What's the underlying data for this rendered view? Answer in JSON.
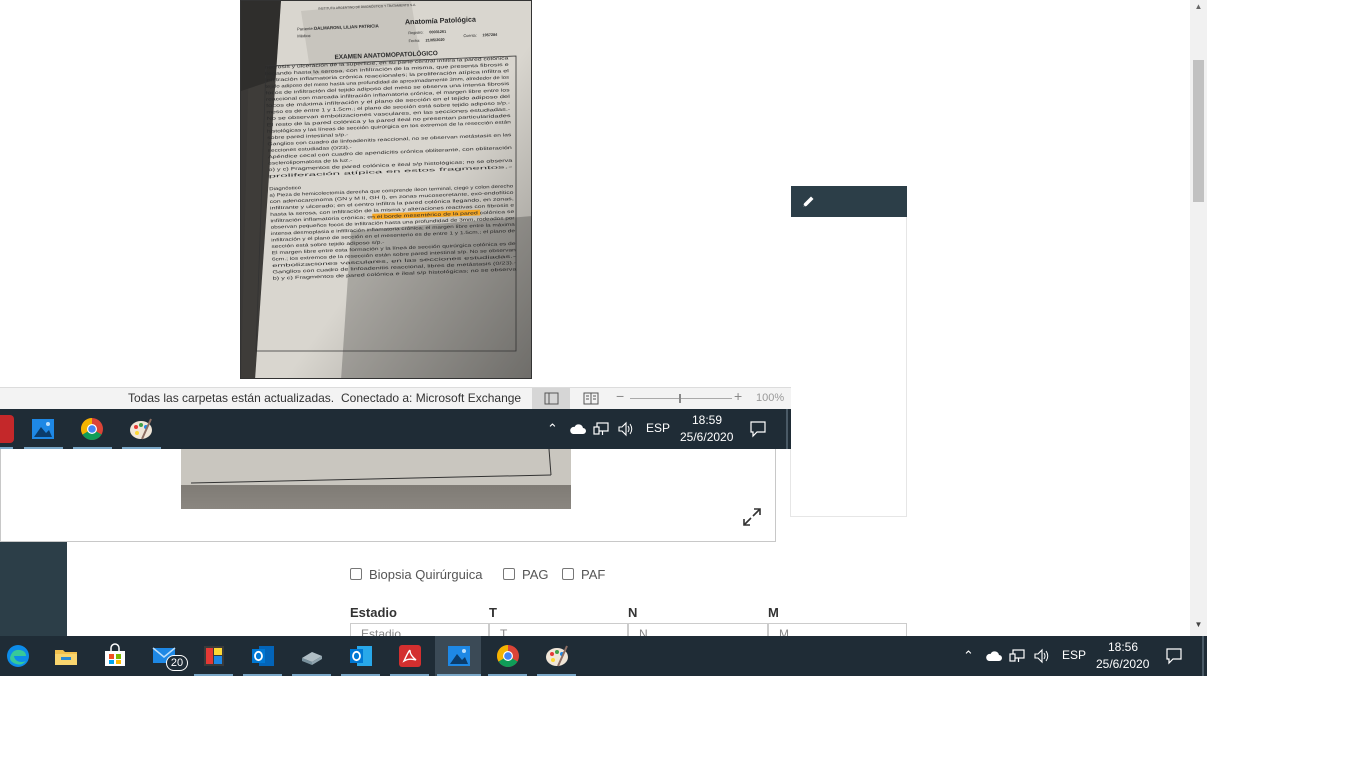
{
  "webpage": {
    "checkboxes": [
      "Biopsia Quirúrguica",
      "PAG",
      "PAF"
    ],
    "stage_headers": [
      "Estadio",
      "T",
      "N",
      "M"
    ],
    "stage_placeholders": [
      "Estadio",
      "T",
      "N",
      "M"
    ]
  },
  "document_photo": {
    "header": {
      "institute": "INSTITUTO ARGENTINO DE DIAGNÓSTICO Y TRATAMIENTO S.A.",
      "department": "Anatomía Patológica",
      "patient_label": "Paciente:",
      "patient_name": "DALMARONI, LILIAN PATRICIA",
      "doctor_label": "Médico:",
      "registro_label": "Registro:",
      "registro": "00031261",
      "fecha_label": "Fecha:",
      "fecha": "21/05/2020",
      "cuenta_label": "Cuenta:",
      "cuenta": "1957284"
    },
    "title": "EXAMEN ANATOMOPATOLÓGICO",
    "body_lines": [
      "necrosis y ulceración de la superficie, en su parte central infiltra la pared colónica",
      "llegando hasta la serosa, con infiltración de la misma, que presenta fibrosis e",
      "infiltración inflamatoria crónica reaccionales; la proliferación atípica infiltra el",
      "tejido adiposo del meso hasta una profundidad de aproximadamente 3mm, alrededor de los",
      "focos de infiltración del tejido adiposo del meso se observa una intensa fibrosis",
      "reaccional con marcada infiltración inflamatoria crónica, el margen libre entre los",
      "focos de máxima infiltración y el plano de sección en el tejido adiposo del",
      "meso es de entre 1 y 1.5cm.; el plano de sección está sobre tejido adiposo s/p.-",
      "No se observan embolizaciones vasculares, en las secciones estudiadas.-",
      "El resto de la pared colónica y la pared ileal no presentan particularidades",
      "histológicas y las líneas de sección quirúrgica en los extremos de la resección están",
      "sobre pared intestinal s/p.-",
      "Ganglios con cuadro de linfoadenitis reaccional, no se observan metástasis en las",
      "secciones estudiadas (0/23).-",
      "Apéndice cecal con cuadro de apendicitis crónica obliterante, con obliteración",
      "esclerolipomatosa de la luz.-",
      "b) y c) Fragmentos de pared colónica e ileal s/p histológicas; no se observa",
      "proliferación atípica en estos fragmentos.-",
      "",
      "Diagnóstico",
      "a) Pieza de hemicolectomía derecha que comprende íleon terminal, ciego y colon derecho",
      "con adenocarcinoma (GN y M II, GH I), en zonas mucosecretante, exo-endofítico",
      "infiltrante y ulcerado; en el centro infiltra la pared colónica llegando, en zonas,",
      "hasta la serosa, con infiltración de la misma y alteraciones reactivas con fibrosis e",
      "infiltración inflamatoria crónica; en el borde mesentérico de la pared colónica se",
      "observan pequeños focos de infiltración hasta una profundidad de 3mm, rodeados por",
      "intensa desmoplasia e infiltración inflamatoria crónica; el margen libre entre la máxima",
      "infiltración y el plano de sección en el mesenterio es de entre 1 y 1.5cm.; el plano de",
      "sección está sobre tejido adiposo s/p.-",
      "El margen libre entre esta formación y la línea de sección quirúrgica colónica es de",
      "6cm.; los extremos de la resección están sobre pared intestinal s/p. No se observan",
      "embolizaciones vasculares, en las secciones estudiadas.-",
      "Ganglios con cuadro de linfoadenitis reaccional, libres de metástasis (0/23).-",
      "b) y c) Fragmentos de pared colónica e ileal s/p histológicas; no se observa"
    ],
    "highlight_line_index": 24
  },
  "outlook_status": {
    "sync": "Todas las carpetas están actualizadas.",
    "connection": "Conectado a: Microsoft Exchange",
    "zoom": "100%"
  },
  "taskbar_inner": {
    "language": "ESP",
    "time": "18:59",
    "date": "25/6/2020"
  },
  "taskbar": {
    "mail_badge": "20",
    "language": "ESP",
    "time": "18:56",
    "date": "25/6/2020"
  },
  "colors": {
    "taskbar": "#1f2c36",
    "sidebar": "#2c3e48",
    "highlight": "#f5a623"
  }
}
